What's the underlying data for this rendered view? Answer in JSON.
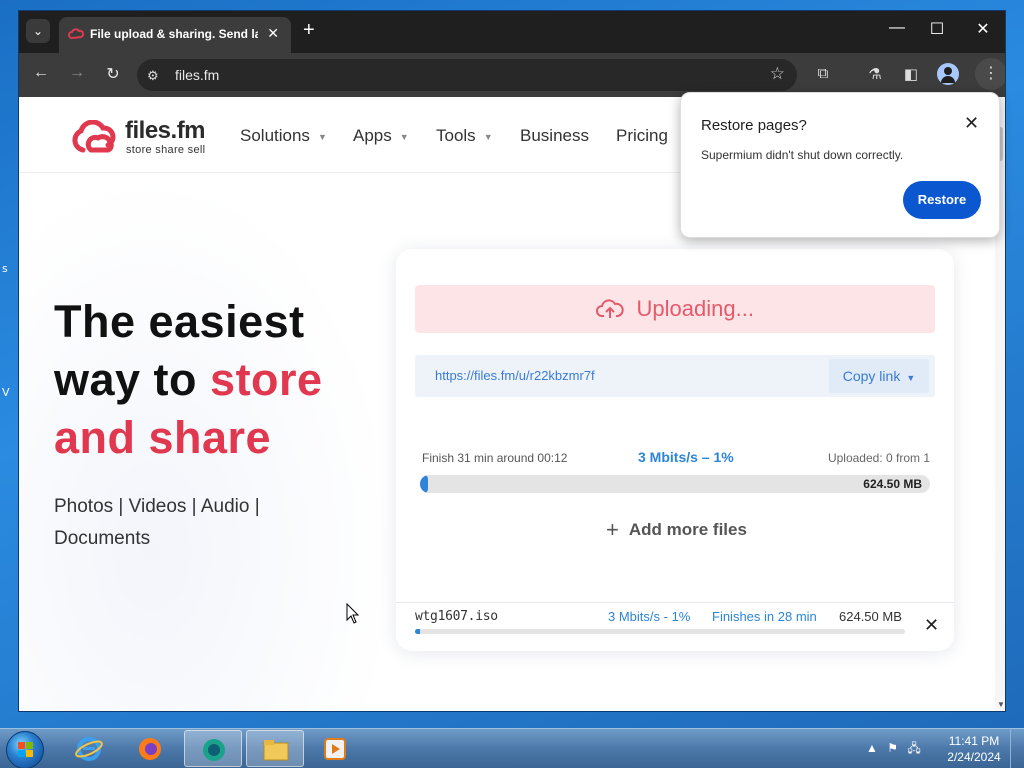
{
  "browser": {
    "tab_title": "File upload & sharing. Send lar",
    "tab_close": "✕",
    "new_tab": "+",
    "url": "files.fm"
  },
  "site": {
    "logo_name": "files.fm",
    "logo_tagline": "store  share  sell",
    "nav": [
      {
        "label": "Solutions",
        "has_caret": true
      },
      {
        "label": "Apps",
        "has_caret": true
      },
      {
        "label": "Tools",
        "has_caret": true
      },
      {
        "label": "Business",
        "has_caret": false
      },
      {
        "label": "Pricing",
        "has_caret": false
      }
    ],
    "hero": {
      "line1": "The easiest",
      "line2_plain": "way to ",
      "line2_accent": "store",
      "line3_accent": "and share",
      "subtitle": "Photos | Videos | Audio | Documents"
    }
  },
  "upload": {
    "status_label": "Uploading...",
    "share_link": "https://files.fm/u/r22kbzmr7f",
    "copy_button": "Copy link",
    "finish_text": "Finish 31 min around 00:12",
    "speed_text": "3 Mbits/s – 1%",
    "uploaded_text": "Uploaded: 0 from 1",
    "total_size": "624.50 MB",
    "progress_percent": 1,
    "add_more_label": "Add more files",
    "file": {
      "name": "wtg1607.iso",
      "speed": "3 Mbits/s - 1%",
      "eta": "Finishes in 28 min",
      "size": "624.50 MB",
      "progress_percent": 1
    }
  },
  "restore_popup": {
    "title": "Restore pages?",
    "message": "Supermium didn't shut down correctly.",
    "button": "Restore"
  },
  "taskbar": {
    "time": "11:41 PM",
    "date": "2/24/2024"
  },
  "colors": {
    "accent_red": "#e0394f",
    "link_blue": "#2d84d8",
    "restore_blue": "#0b57d0"
  }
}
